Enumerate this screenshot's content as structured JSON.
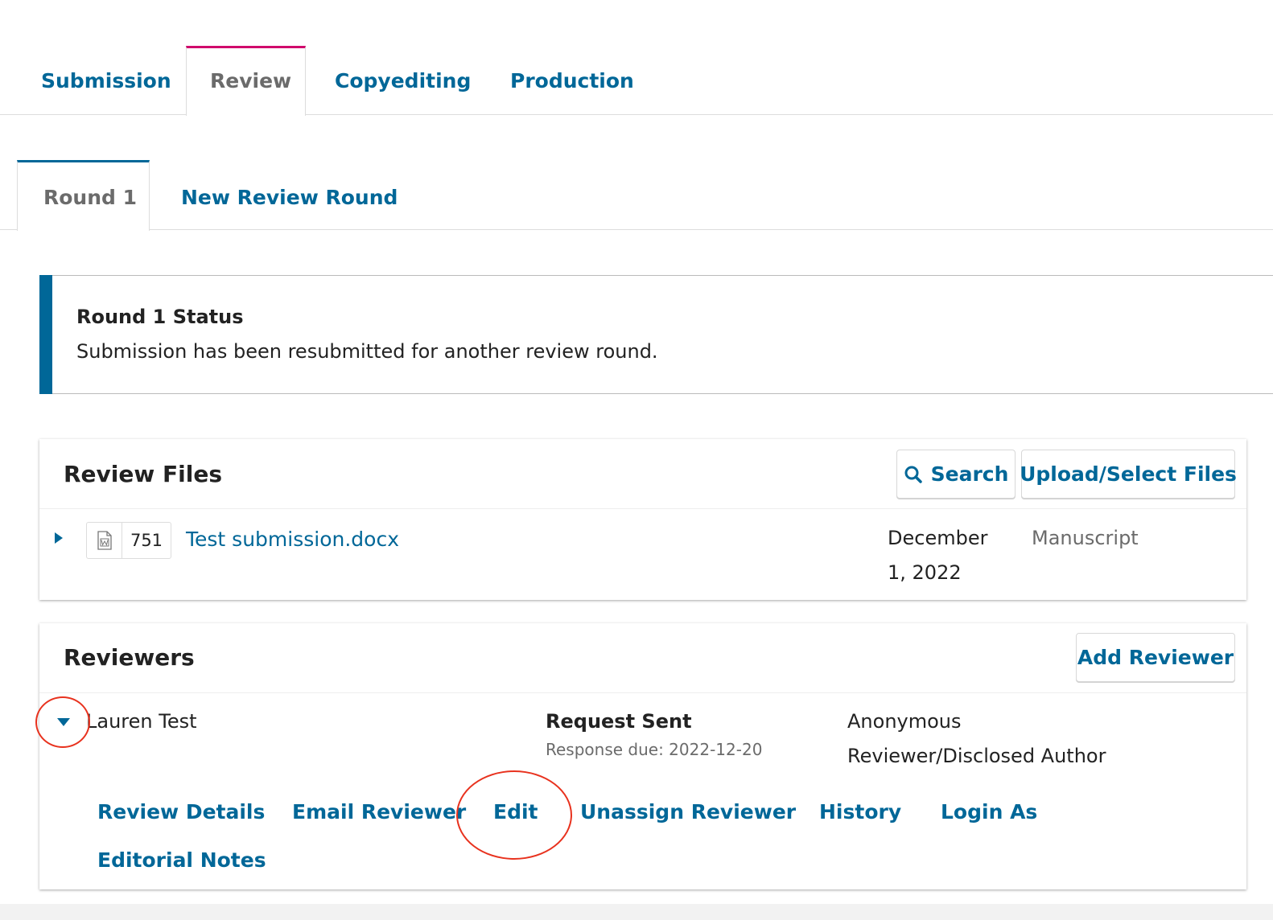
{
  "main_tabs": [
    "Submission",
    "Review",
    "Copyediting",
    "Production"
  ],
  "round_tabs": [
    "Round 1",
    "New Review Round"
  ],
  "status": {
    "title": "Round 1 Status",
    "text": "Submission has been resubmitted for another review round."
  },
  "review_files": {
    "title": "Review Files",
    "search_label": "Search",
    "upload_label": "Upload/Select Files",
    "files": [
      {
        "id": "751",
        "name": "Test submission.docx",
        "date_line1": "December",
        "date_line2": "1, 2022",
        "type": "Manuscript"
      }
    ]
  },
  "reviewers": {
    "title": "Reviewers",
    "add_label": "Add Reviewer",
    "items": [
      {
        "name": "Lauren Test",
        "status": "Request Sent",
        "due": "Response due: 2022-12-20",
        "method_line1": "Anonymous",
        "method_line2": "Reviewer/Disclosed Author",
        "actions": [
          "Review Details",
          "Email Reviewer",
          "Edit",
          "Unassign Reviewer",
          "History",
          "Login As",
          "Editorial Notes"
        ]
      }
    ]
  },
  "colors": {
    "link": "#006798",
    "active_tab_accent": "#d00a6c",
    "annotation": "#e8321e"
  }
}
